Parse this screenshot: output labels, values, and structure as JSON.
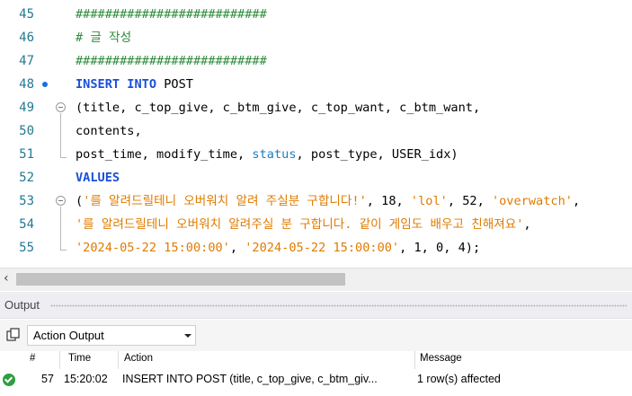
{
  "editor": {
    "lines": [
      {
        "num": "45",
        "parts": [
          {
            "t": "##########################",
            "c": "cm"
          }
        ]
      },
      {
        "num": "46",
        "parts": [
          {
            "t": "# 글 작성",
            "c": "cm"
          }
        ]
      },
      {
        "num": "47",
        "parts": [
          {
            "t": "##########################",
            "c": "cm"
          }
        ]
      },
      {
        "num": "48",
        "parts": [
          {
            "t": "INSERT INTO",
            "c": "kw"
          },
          {
            "t": " POST",
            "c": "nm"
          }
        ]
      },
      {
        "num": "49",
        "parts": [
          {
            "t": "(title, c_top_give, c_btm_give, c_top_want, c_btm_want,",
            "c": "nm"
          }
        ]
      },
      {
        "num": "50",
        "parts": [
          {
            "t": "contents,",
            "c": "nm"
          }
        ]
      },
      {
        "num": "51",
        "parts": [
          {
            "t": "post_time, modify_time, ",
            "c": "nm"
          },
          {
            "t": "status",
            "c": "fn"
          },
          {
            "t": ", post_type, USER_idx)",
            "c": "nm"
          }
        ]
      },
      {
        "num": "52",
        "parts": [
          {
            "t": "VALUES",
            "c": "kw"
          }
        ]
      },
      {
        "num": "53",
        "parts": [
          {
            "t": "(",
            "c": "nm"
          },
          {
            "t": "'를 알려드릴테니 오버워치 알려 주실분 구합니다!'",
            "c": "st"
          },
          {
            "t": ", 18, ",
            "c": "nm"
          },
          {
            "t": "'lol'",
            "c": "st"
          },
          {
            "t": ", 52, ",
            "c": "nm"
          },
          {
            "t": "'overwatch'",
            "c": "st"
          },
          {
            "t": ",",
            "c": "nm"
          }
        ]
      },
      {
        "num": "54",
        "parts": [
          {
            "t": "'를 알려드릴테니 오버워치 알려주실 분 구합니다. 같이 게임도 배우고 친해져요'",
            "c": "st"
          },
          {
            "t": ",",
            "c": "nm"
          }
        ]
      },
      {
        "num": "55",
        "parts": [
          {
            "t": "'2024-05-22 15:00:00'",
            "c": "st"
          },
          {
            "t": ", ",
            "c": "nm"
          },
          {
            "t": "'2024-05-22 15:00:00'",
            "c": "st"
          },
          {
            "t": ", 1, 0, 4);",
            "c": "nm"
          }
        ]
      }
    ]
  },
  "output": {
    "title": "Output",
    "source_selected": "Action Output",
    "columns": [
      "#",
      "Time",
      "Action",
      "Message"
    ],
    "rows": [
      {
        "status": "success",
        "num": "57",
        "time": "15:20:02",
        "action": "INSERT INTO POST  (title, c_top_give, c_btm_giv...",
        "message": "1 row(s) affected"
      }
    ]
  },
  "icons": {
    "breakpoint": "breakpoint-dot-icon",
    "fold": "fold-collapse-icon",
    "scroll_left": "scroll-left-arrow-icon",
    "copy": "copy-icon",
    "dropdown": "chevron-down-icon",
    "status_ok": "success-check-icon"
  },
  "colors": {
    "comment": "#2e8b3c",
    "keyword": "#1a4fd8",
    "string": "#e07b00",
    "line_number": "#237893",
    "success": "#2e9e3f"
  }
}
